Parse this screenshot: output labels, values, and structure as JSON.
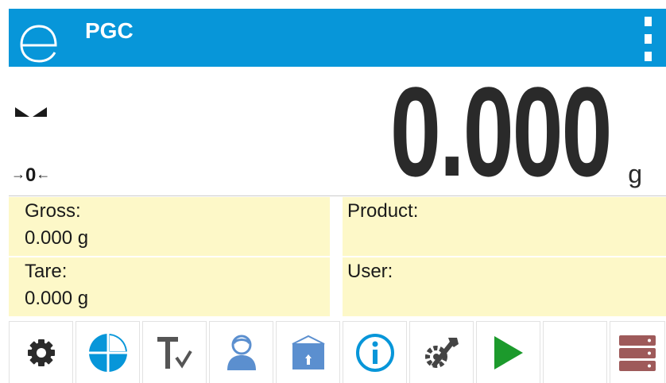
{
  "header": {
    "logo_icon": "logo-e-icon",
    "title": "PGC",
    "menu_icon": "more-vertical-icon",
    "background": "#0796d9"
  },
  "weighing": {
    "value": "0.000",
    "unit": "g",
    "stable_icon": "stability-marker-icon",
    "zero_indicator": "0"
  },
  "info": {
    "gross_label": "Gross:",
    "gross_value": "0.000 g",
    "tare_label": "Tare:",
    "tare_value": "0.000 g",
    "product_label": "Product:",
    "product_value": "",
    "user_label": "User:",
    "user_value": "",
    "background": "#fdf8c8"
  },
  "toolbar": {
    "buttons": [
      {
        "icon": "settings-gear-icon",
        "color": "#2b2b2b"
      },
      {
        "icon": "pie-chart-icon",
        "color": "#0796d9"
      },
      {
        "icon": "tare-check-icon",
        "color": "#555555"
      },
      {
        "icon": "user-icon",
        "color": "#5b8fcf"
      },
      {
        "icon": "product-box-icon",
        "color": "#5b8fcf"
      },
      {
        "icon": "info-icon",
        "color": "#0796d9"
      },
      {
        "icon": "tools-icon",
        "color": "#444444"
      },
      {
        "icon": "play-start-icon",
        "color": "#1c9a2c"
      },
      {
        "icon": "empty-slot-icon",
        "color": "#ffffff"
      },
      {
        "icon": "database-icon",
        "color": "#9e5a5a"
      }
    ]
  }
}
